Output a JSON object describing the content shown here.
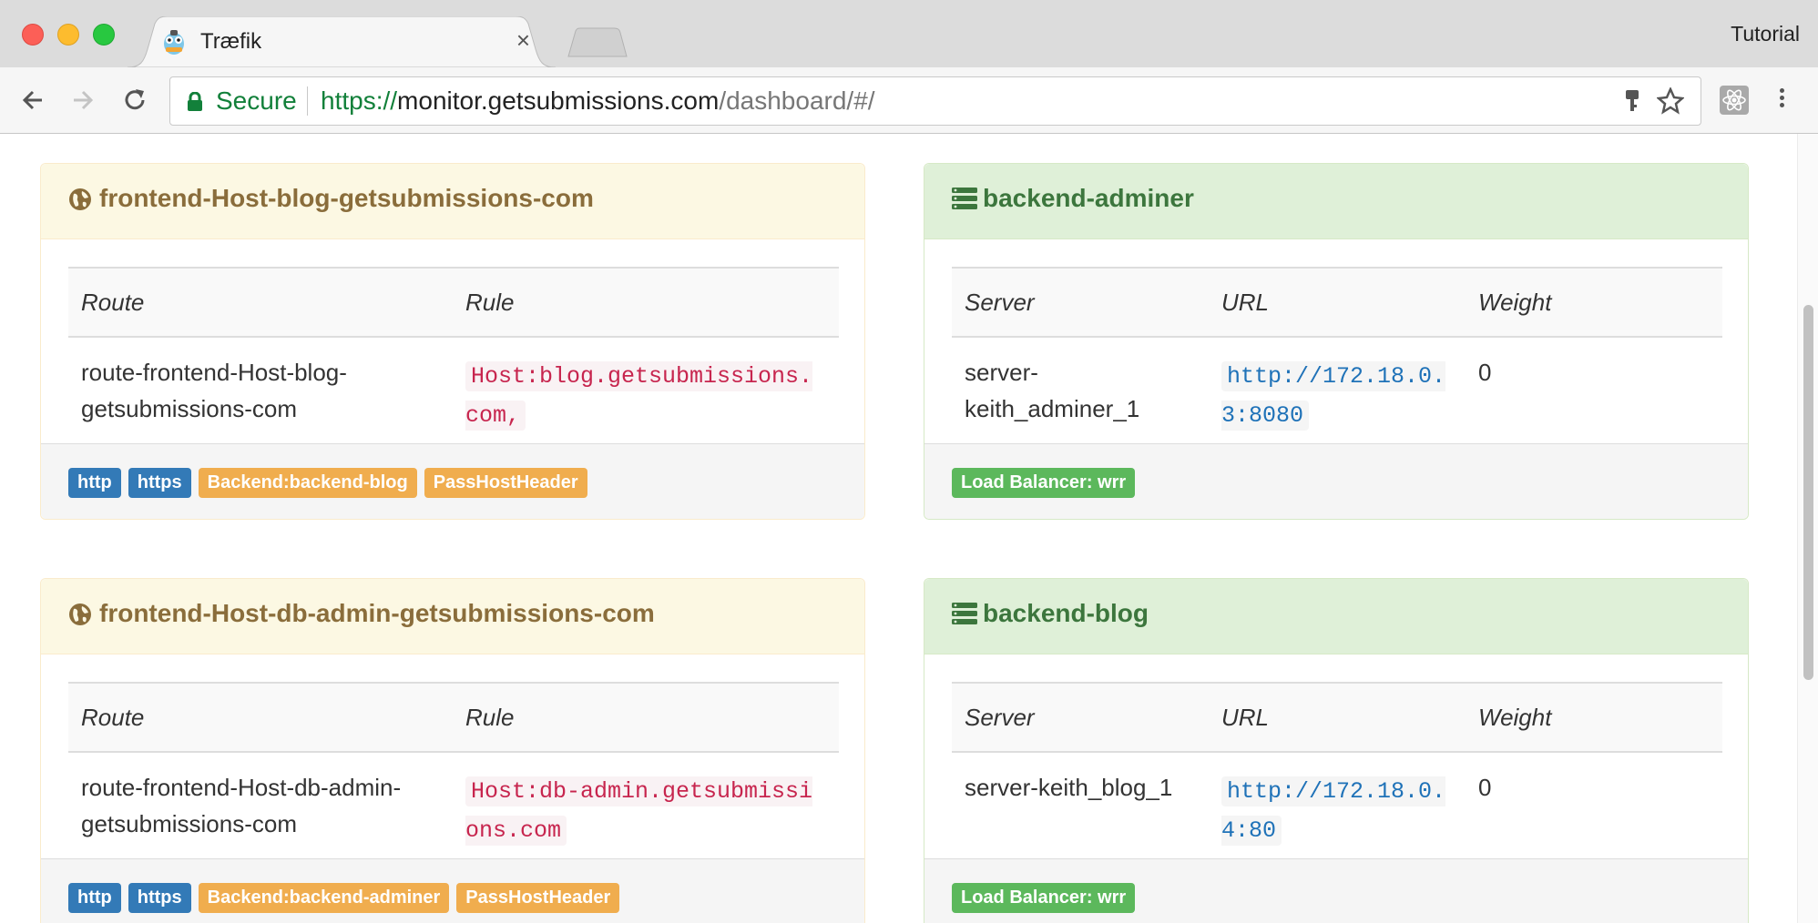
{
  "browser": {
    "tab_title": "Træfik",
    "tab_close": "×",
    "profile_name": "Tutorial",
    "secure_label": "Secure",
    "url_scheme": "https://",
    "url_host": "monitor.getsubmissions.com",
    "url_path": "/dashboard/#/"
  },
  "frontends": [
    {
      "name": "frontend-Host-blog-getsubmissions-com",
      "columns": [
        "Route",
        "Rule"
      ],
      "route": "route-frontend-Host-blog-getsubmissions-com",
      "rule": "Host:blog.getsubmissions.com,",
      "labels": [
        "http",
        "https",
        "Backend:backend-blog",
        "PassHostHeader"
      ]
    },
    {
      "name": "frontend-Host-db-admin-getsubmissions-com",
      "columns": [
        "Route",
        "Rule"
      ],
      "route": "route-frontend-Host-db-admin-getsubmissions-com",
      "rule": "Host:db-admin.getsubmissions.com",
      "labels": [
        "http",
        "https",
        "Backend:backend-adminer",
        "PassHostHeader"
      ]
    }
  ],
  "backends": [
    {
      "name": "backend-adminer",
      "columns": [
        "Server",
        "URL",
        "Weight"
      ],
      "server": "server-keith_adminer_1",
      "url": "http://172.18.0.3:8080",
      "weight": "0",
      "label": "Load Balancer: wrr"
    },
    {
      "name": "backend-blog",
      "columns": [
        "Server",
        "URL",
        "Weight"
      ],
      "server": "server-keith_blog_1",
      "url": "http://172.18.0.4:80",
      "weight": "0",
      "label": "Load Balancer: wrr"
    }
  ],
  "colors": {
    "frontend_header_bg": "#fcf8e3",
    "frontend_header_text": "#8a6d3b",
    "backend_header_bg": "#dff0d8",
    "backend_header_text": "#3c763d",
    "label_primary": "#337ab7",
    "label_warning": "#f0ad4e",
    "label_success": "#5cb85c"
  },
  "icons": {
    "frontend": "globe-icon",
    "backend": "server-icon",
    "address": "lock-icon"
  }
}
